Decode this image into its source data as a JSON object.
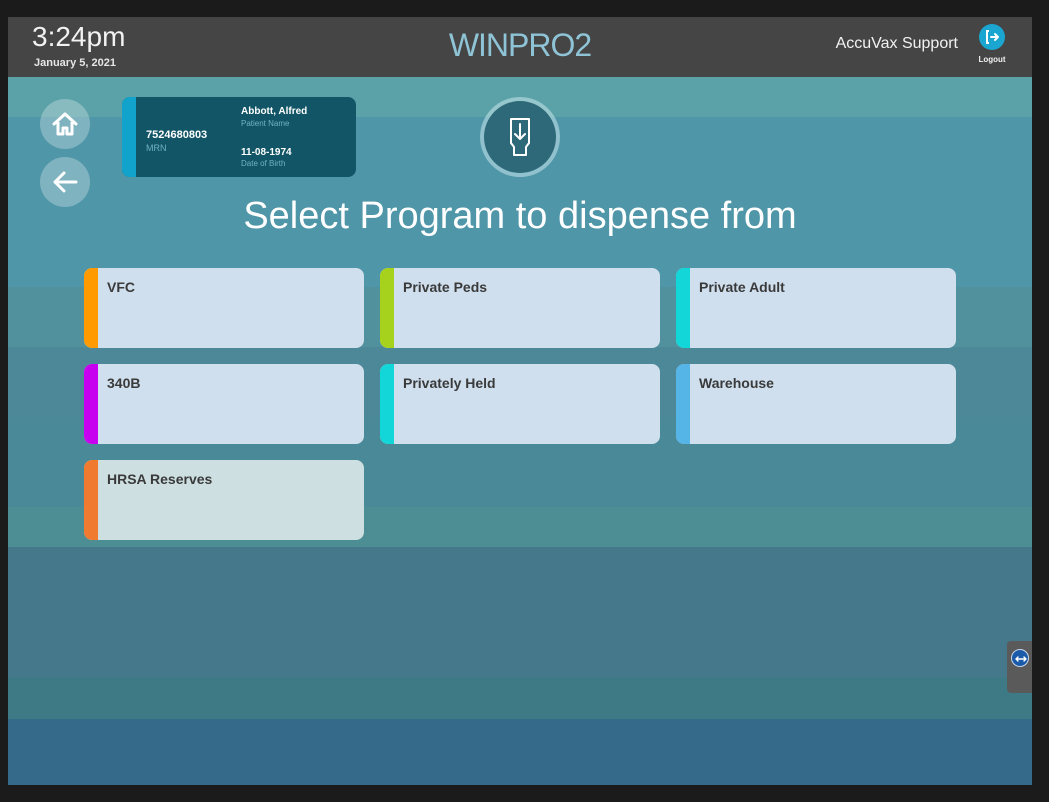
{
  "header": {
    "time": "3:24pm",
    "date": "January 5, 2021",
    "brand": "WINPRO2",
    "user": "AccuVax Support",
    "logout_label": "Logout"
  },
  "nav": {
    "home_icon": "home-icon",
    "back_icon": "arrow-left-icon"
  },
  "patient": {
    "mrn": "7524680803",
    "mrn_label": "MRN",
    "name": "Abbott, Alfred",
    "name_label": "Patient Name",
    "dob": "11-08-1974",
    "dob_label": "Date of Birth"
  },
  "dispense_icon": "dispense-vial-icon",
  "heading": "Select Program to dispense from",
  "programs": [
    {
      "label": "VFC",
      "color": "#ff9b00"
    },
    {
      "label": "Private Peds",
      "color": "#a6d21e"
    },
    {
      "label": "Private Adult",
      "color": "#12d6d8"
    },
    {
      "label": "340B",
      "color": "#c800f0"
    },
    {
      "label": "Privately Held",
      "color": "#12d6d8"
    },
    {
      "label": "Warehouse",
      "color": "#55b5e6"
    },
    {
      "label": "HRSA Reserves",
      "color": "#f07a30"
    }
  ],
  "colors": {
    "topbar": "#454545",
    "brand": "#8fc3d6",
    "patient_card": "#115566",
    "patient_stripe": "#11a3cc",
    "tile": "#cfdfee",
    "logout": "#1aa6d1"
  }
}
